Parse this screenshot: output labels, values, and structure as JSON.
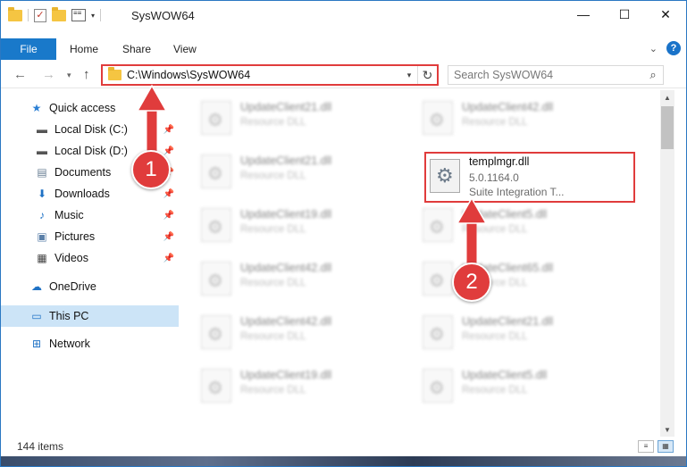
{
  "window": {
    "title": "SysWOW64",
    "controls": {
      "minimize": "—",
      "maximize": "☐",
      "close": "✕"
    }
  },
  "ribbon": {
    "tabs": [
      "File",
      "Home",
      "Share",
      "View"
    ],
    "help_label": "?"
  },
  "navigation": {
    "address": "C:\\Windows\\SysWOW64",
    "search_placeholder": "Search SysWOW64"
  },
  "sidebar": {
    "items": [
      {
        "label": "Quick access",
        "icon": "star-icon"
      },
      {
        "label": "Local Disk (C:)",
        "icon": "drive-icon"
      },
      {
        "label": "Local Disk (D:)",
        "icon": "drive-icon"
      },
      {
        "label": "Documents",
        "icon": "documents-icon"
      },
      {
        "label": "Downloads",
        "icon": "download-icon"
      },
      {
        "label": "Music",
        "icon": "music-icon"
      },
      {
        "label": "Pictures",
        "icon": "pictures-icon"
      },
      {
        "label": "Videos",
        "icon": "videos-icon"
      },
      {
        "label": "OneDrive",
        "icon": "cloud-icon"
      },
      {
        "label": "This PC",
        "icon": "computer-icon"
      },
      {
        "label": "Network",
        "icon": "network-icon"
      }
    ]
  },
  "files": {
    "left": [
      {
        "name": "UpdateClient21.dll",
        "type": "Resource DLL"
      },
      {
        "name": "UpdateClient21.dll",
        "type": "Resource DLL"
      },
      {
        "name": "UpdateClient19.dll",
        "type": "Resource DLL"
      },
      {
        "name": "UpdateClient42.dll",
        "type": "Resource DLL"
      },
      {
        "name": "UpdateClient42.dll",
        "type": "Resource DLL"
      },
      {
        "name": "UpdateClient19.dll",
        "type": "Resource DLL"
      }
    ],
    "right": [
      {
        "name": "UpdateClient42.dll",
        "type": "Resource DLL"
      },
      {
        "name": "UpdateClient5.dll",
        "type": "Resource DLL"
      },
      {
        "name": "UpdateClient65.dll",
        "type": "Resource DLL"
      },
      {
        "name": "UpdateClient21.dll",
        "type": "Resource DLL"
      },
      {
        "name": "UpdateClient5.dll",
        "type": "Resource DLL"
      }
    ],
    "highlighted": {
      "name": "templmgr.dll",
      "version": "5.0.1164.0",
      "description": "Suite Integration T..."
    }
  },
  "status": {
    "item_count": "144 items"
  },
  "annotations": {
    "step1": "1",
    "step2": "2",
    "color": "#e03c3c"
  }
}
